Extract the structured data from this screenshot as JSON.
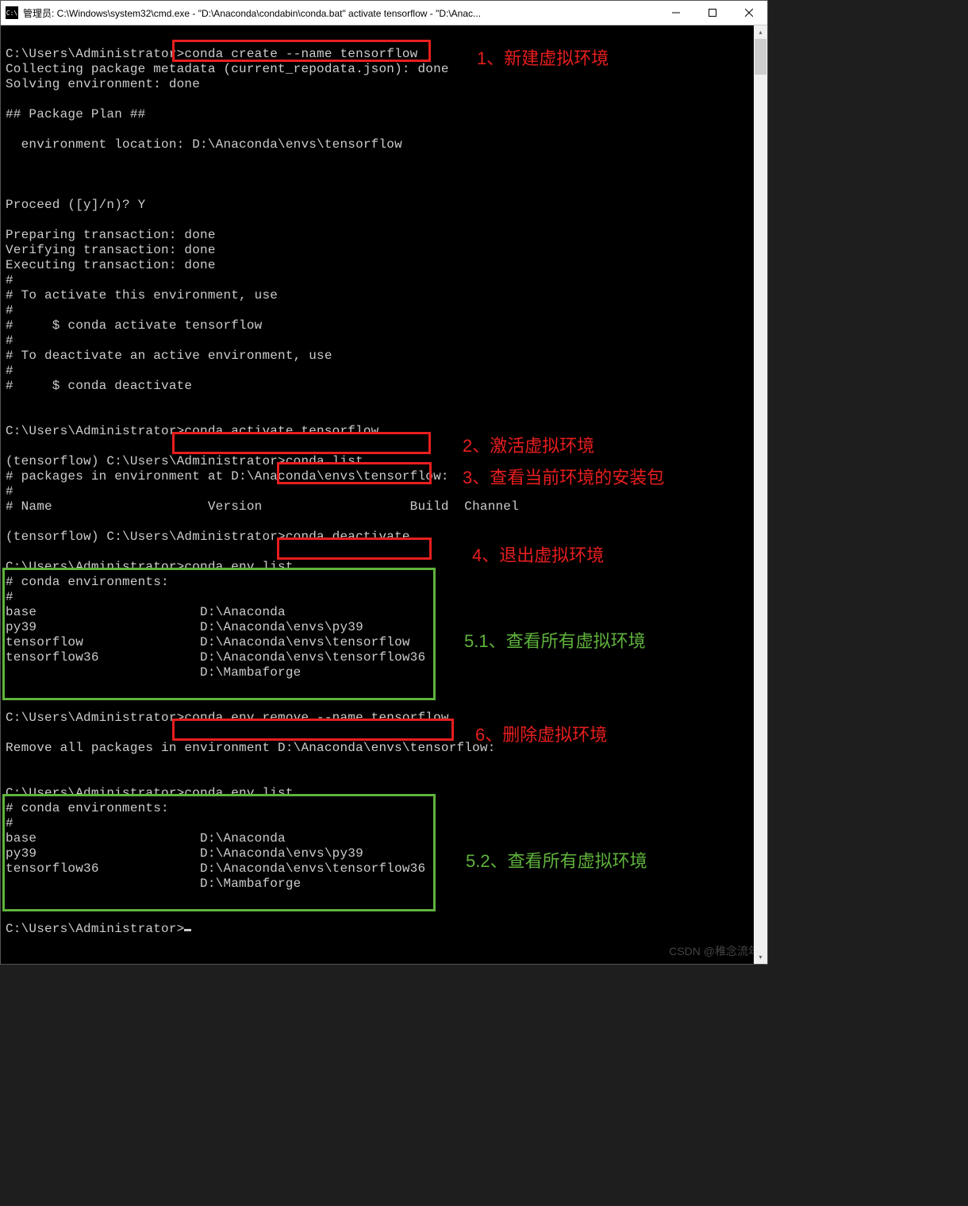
{
  "window": {
    "title": "管理员: C:\\Windows\\system32\\cmd.exe - \"D:\\Anaconda\\condabin\\conda.bat\"  activate tensorflow - \"D:\\Anac...",
    "icon_label": "C:\\"
  },
  "terminal_lines": [
    "",
    "C:\\Users\\Administrator>conda create --name tensorflow",
    "Collecting package metadata (current_repodata.json): done",
    "Solving environment: done",
    "",
    "## Package Plan ##",
    "",
    "  environment location: D:\\Anaconda\\envs\\tensorflow",
    "",
    "",
    "",
    "Proceed ([y]/n)? Y",
    "",
    "Preparing transaction: done",
    "Verifying transaction: done",
    "Executing transaction: done",
    "#",
    "# To activate this environment, use",
    "#",
    "#     $ conda activate tensorflow",
    "#",
    "# To deactivate an active environment, use",
    "#",
    "#     $ conda deactivate",
    "",
    "",
    "C:\\Users\\Administrator>conda activate tensorflow",
    "",
    "(tensorflow) C:\\Users\\Administrator>conda list",
    "# packages in environment at D:\\Anaconda\\envs\\tensorflow:",
    "#",
    "# Name                    Version                   Build  Channel",
    "",
    "(tensorflow) C:\\Users\\Administrator>conda deactivate",
    "",
    "C:\\Users\\Administrator>conda env list",
    "# conda environments:",
    "#",
    "base                     D:\\Anaconda",
    "py39                     D:\\Anaconda\\envs\\py39",
    "tensorflow               D:\\Anaconda\\envs\\tensorflow",
    "tensorflow36             D:\\Anaconda\\envs\\tensorflow36",
    "                         D:\\Mambaforge",
    "",
    "",
    "C:\\Users\\Administrator>conda env remove --name tensorflow",
    "",
    "Remove all packages in environment D:\\Anaconda\\envs\\tensorflow:",
    "",
    "",
    "C:\\Users\\Administrator>conda env list",
    "# conda environments:",
    "#",
    "base                     D:\\Anaconda",
    "py39                     D:\\Anaconda\\envs\\py39",
    "tensorflow36             D:\\Anaconda\\envs\\tensorflow36",
    "                         D:\\Mambaforge",
    "",
    "",
    "C:\\Users\\Administrator>"
  ],
  "annotations": {
    "a1": "1、新建虚拟环境",
    "a2": "2、激活虚拟环境",
    "a3": "3、查看当前环境的安装包",
    "a4": "4、退出虚拟环境",
    "a51": "5.1、查看所有虚拟环境",
    "a6": "6、删除虚拟环境",
    "a52": "5.2、查看所有虚拟环境"
  },
  "commands": {
    "c1": "conda create --name tensorflow",
    "c2": "conda activate tensorflow",
    "c3": "conda list",
    "c4": "conda deactivate",
    "c5": "conda env list",
    "c6": "conda env remove --name tensorflow"
  },
  "watermark": "CSDN @稚念流年"
}
